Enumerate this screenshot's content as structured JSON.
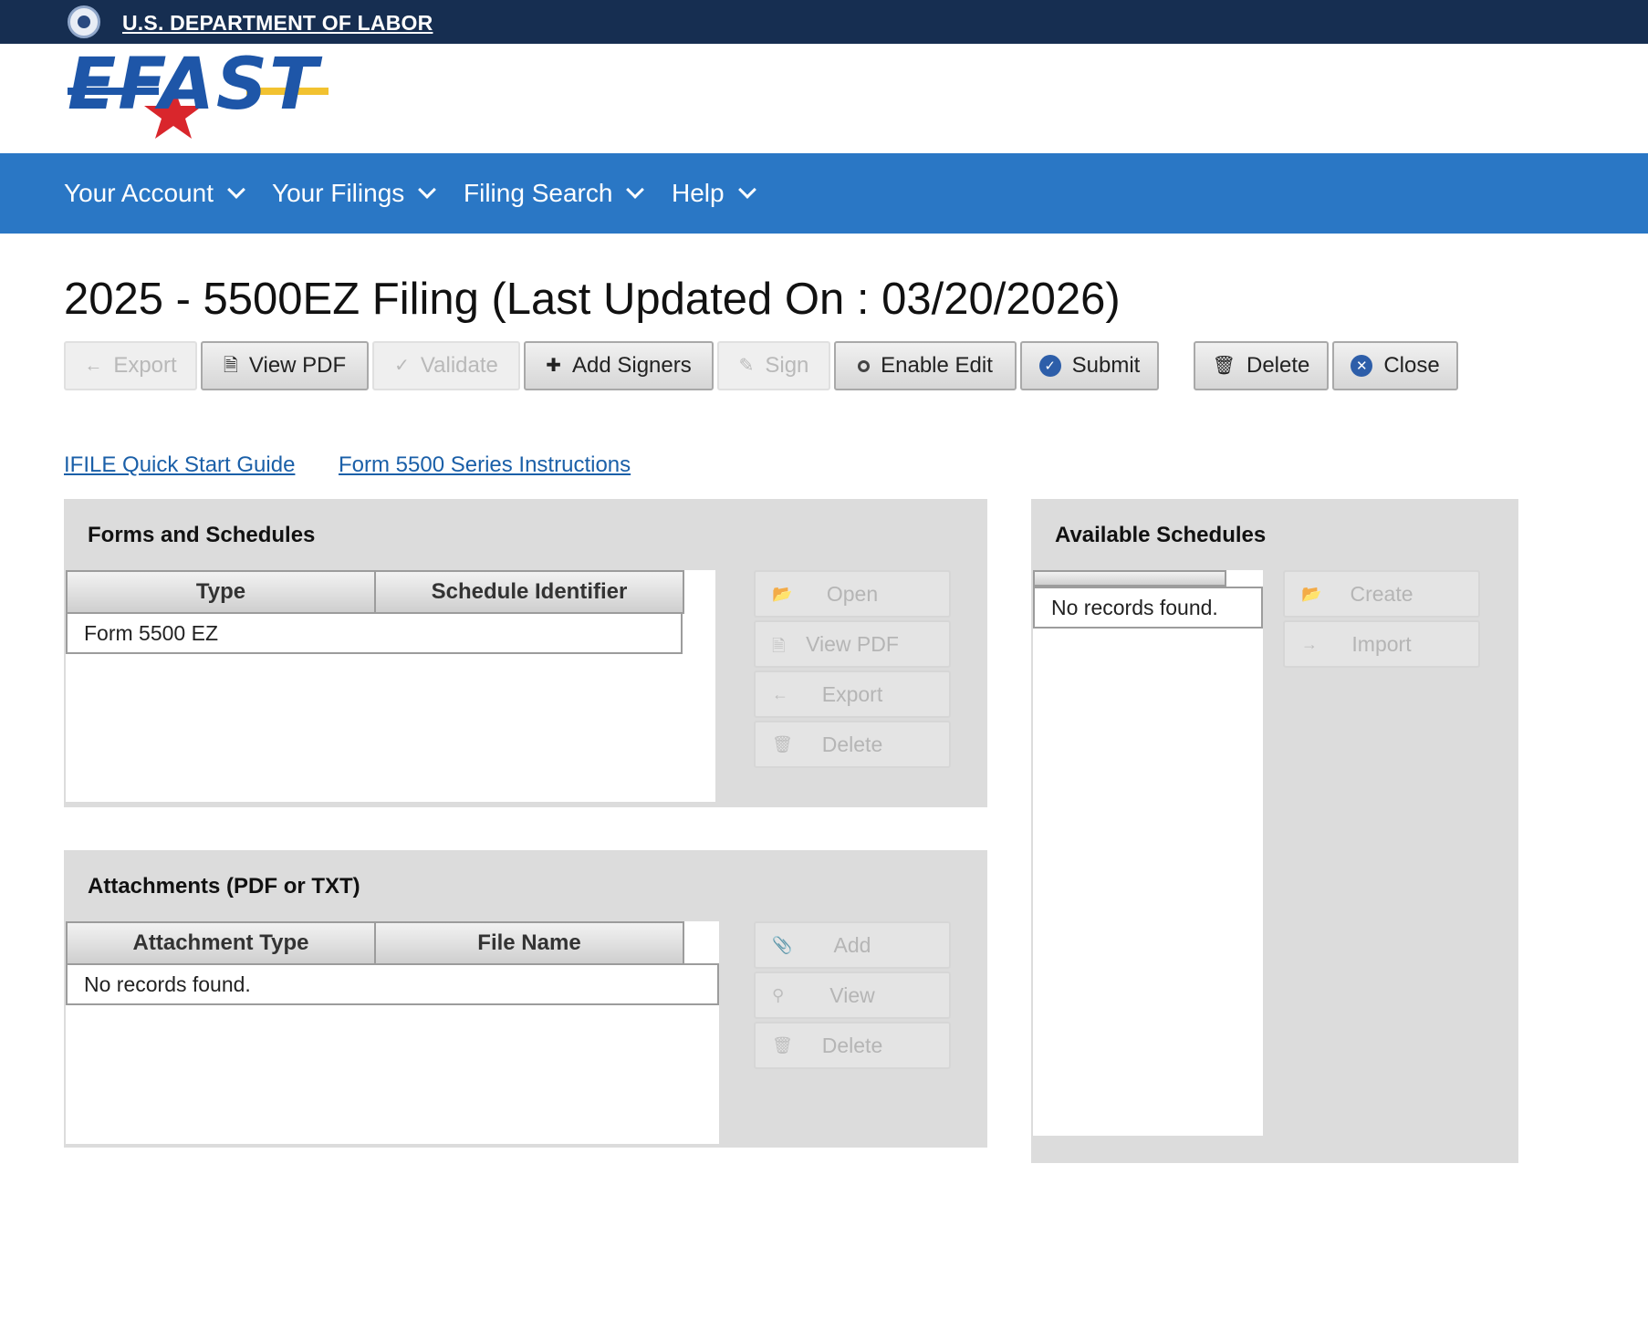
{
  "gov_banner": {
    "agency_link": "U.S. DEPARTMENT OF LABOR"
  },
  "logo": {
    "text": "EFAST"
  },
  "nav": {
    "items": [
      {
        "label": "Your Account"
      },
      {
        "label": "Your Filings"
      },
      {
        "label": "Filing Search"
      },
      {
        "label": "Help"
      }
    ]
  },
  "page": {
    "title": "2025 - 5500EZ Filing (Last Updated On : 03/20/2026)"
  },
  "toolbar": {
    "export": "Export",
    "view_pdf": "View PDF",
    "validate": "Validate",
    "add_signers": "Add Signers",
    "sign": "Sign",
    "enable_edit": "Enable Edit",
    "submit": "Submit",
    "delete": "Delete",
    "close": "Close"
  },
  "links": {
    "quick_start": "IFILE Quick Start Guide",
    "instructions": "Form 5500 Series Instructions"
  },
  "forms_panel": {
    "title": "Forms and Schedules",
    "columns": [
      "Type",
      "Schedule Identifier"
    ],
    "rows": [
      [
        "Form 5500 EZ",
        ""
      ]
    ],
    "actions": {
      "open": "Open",
      "view_pdf": "View PDF",
      "export": "Export",
      "delete": "Delete"
    }
  },
  "attachments_panel": {
    "title": "Attachments (PDF or TXT)",
    "columns": [
      "Attachment Type",
      "File Name"
    ],
    "empty_text": "No records found.",
    "actions": {
      "add": "Add",
      "view": "View",
      "delete": "Delete"
    }
  },
  "schedules_panel": {
    "title": "Available Schedules",
    "empty_text": "No records found.",
    "actions": {
      "create": "Create",
      "import": "Import"
    }
  },
  "colors": {
    "gov_bar": "#162e51",
    "nav_bar": "#2a77c5",
    "link": "#1a5fa8",
    "panel_bg": "#dcdcdc"
  }
}
